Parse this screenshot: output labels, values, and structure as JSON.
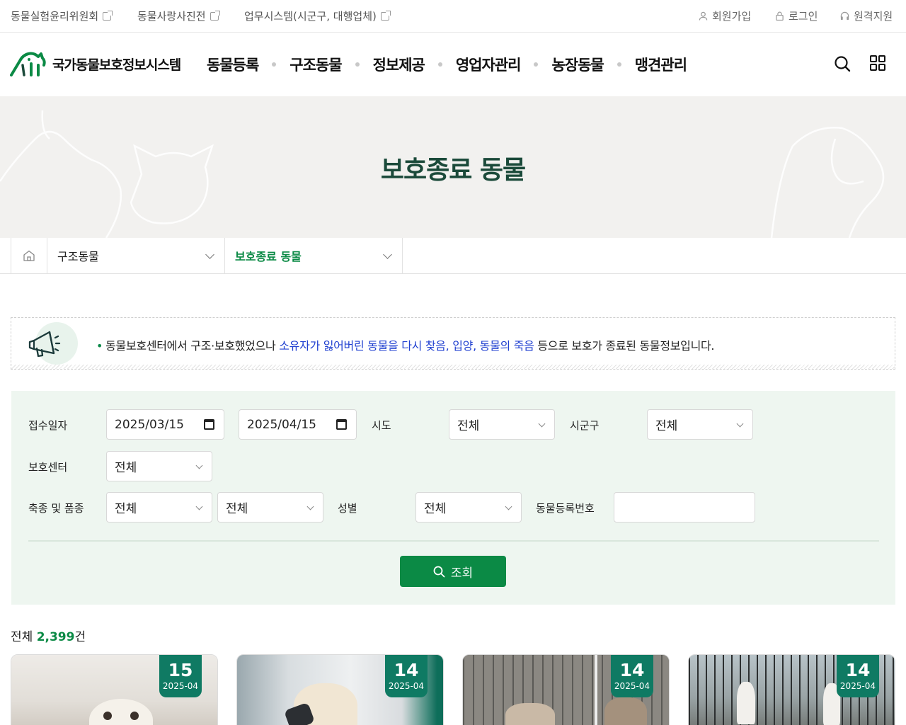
{
  "top_links": [
    {
      "label": "동물실험윤리위원회"
    },
    {
      "label": "동물사랑사진전"
    },
    {
      "label": "업무시스템(시군구, 대행업체)"
    }
  ],
  "utility": {
    "signup": "회원가입",
    "login": "로그인",
    "remote": "원격지원"
  },
  "logo": {
    "text": "국가동물보호정보시스템"
  },
  "gnb": [
    "동물등록",
    "구조동물",
    "정보제공",
    "영업자관리",
    "농장동물",
    "맹견관리"
  ],
  "banner": {
    "title": "보호종료 동물"
  },
  "breadcrumb": {
    "level1": "구조동물",
    "level2": "보호종료 동물"
  },
  "notice": {
    "prefix": "동물보호센터에서 구조·보호했었으나 ",
    "highlight": "소유자가 잃어버린 동물을 다시 찾음, 입양, 동물의 죽음",
    "suffix": " 등으로 보호가 종료된 동물정보입니다."
  },
  "search": {
    "receipt_label": "접수일자",
    "date_from": "2025/03/15",
    "date_sep": "~",
    "date_to": "2025/04/15",
    "sido_label": "시도",
    "sido_value": "전체",
    "sigungu_label": "시군구",
    "sigungu_value": "전체",
    "center_label": "보호센터",
    "center_value": "전체",
    "species_label": "축종 및 품종",
    "species_value": "전체",
    "breed_value": "전체",
    "sex_label": "성별",
    "sex_value": "전체",
    "regno_label": "동물등록번호",
    "regno_value": "",
    "button": "조회"
  },
  "results": {
    "total_prefix": "전체 ",
    "total_count": "2,399",
    "total_suffix": "건",
    "cards": [
      {
        "day": "15",
        "ym": "2025-04",
        "color": "#e9e6e1"
      },
      {
        "day": "14",
        "ym": "2025-04",
        "color": "#d9d4cc"
      },
      {
        "day": "14",
        "ym": "2025-04",
        "color": "#7c7a74"
      },
      {
        "day": "14",
        "ym": "2025-04",
        "color": "#9aa0a2"
      }
    ]
  },
  "colors": {
    "brand_green": "#0b8a45",
    "title_green": "#1b4a3a",
    "badge_teal": "#0f7a63",
    "link_blue": "#1f3fd0",
    "search_bg": "#eef6f0"
  }
}
